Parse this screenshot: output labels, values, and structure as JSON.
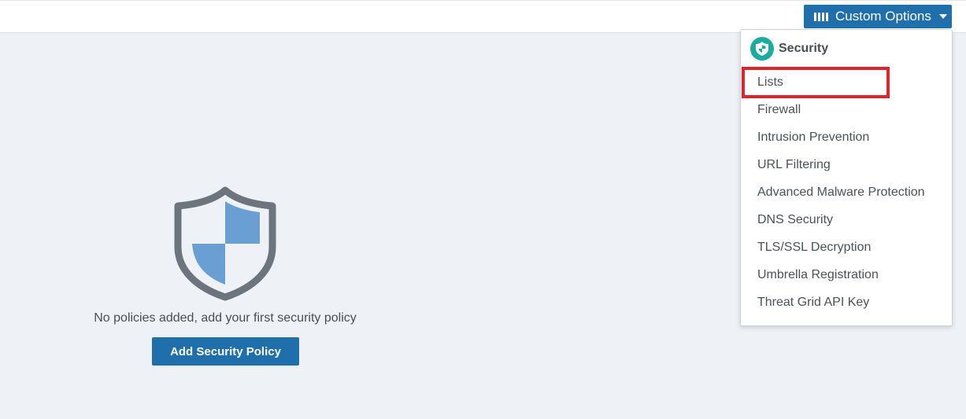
{
  "topbar": {
    "custom_options_label": "Custom Options",
    "button_color": "#1f6fad"
  },
  "empty_state": {
    "message": "No policies added, add your first security policy",
    "add_button_label": "Add Security Policy",
    "icon": "shield-icon"
  },
  "dropdown": {
    "header_icon": "shield-icon",
    "header_label": "Security",
    "items": [
      {
        "label": "Lists"
      },
      {
        "label": "Firewall"
      },
      {
        "label": "Intrusion Prevention"
      },
      {
        "label": "URL Filtering"
      },
      {
        "label": "Advanced Malware Protection"
      },
      {
        "label": "DNS Security"
      },
      {
        "label": "TLS/SSL Decryption"
      },
      {
        "label": "Umbrella Registration"
      },
      {
        "label": "Threat Grid API Key"
      }
    ],
    "highlighted_item": "Lists",
    "highlight_color": "#e0232b"
  }
}
